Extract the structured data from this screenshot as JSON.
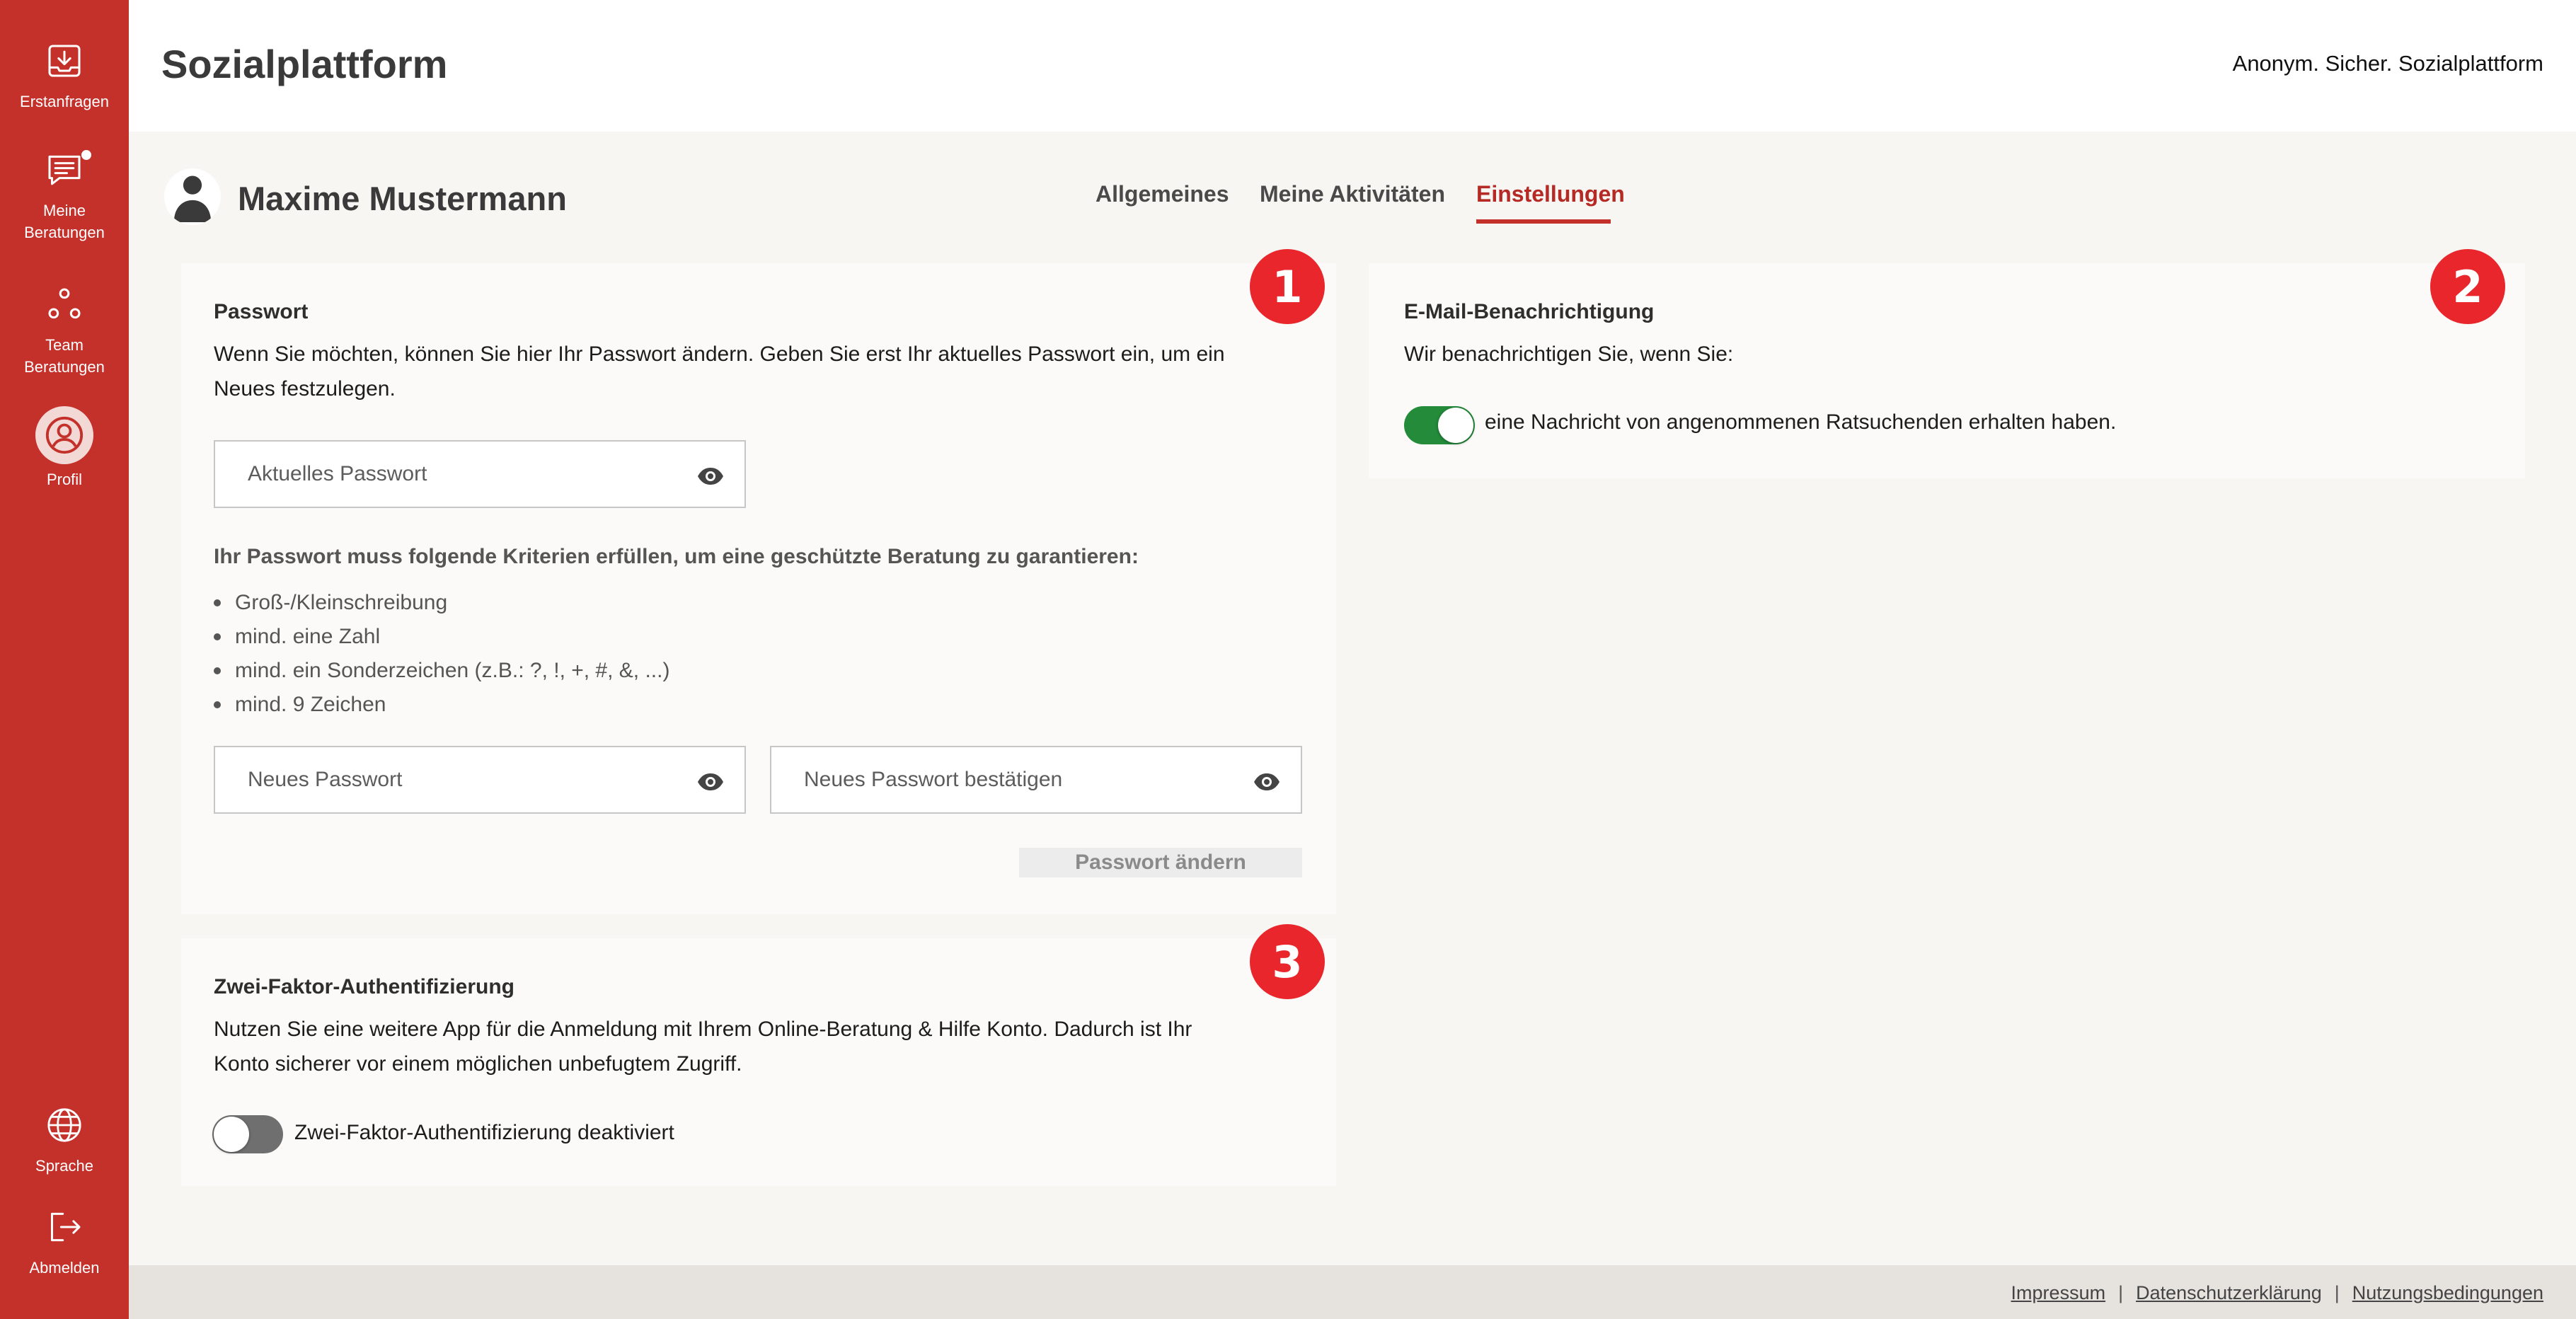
{
  "colors": {
    "brand": "#c4302a",
    "badge": "#e8262b",
    "toggle_on": "#238b3a",
    "toggle_off": "#6f6f6f"
  },
  "sidebar": {
    "items": [
      {
        "label": "Erstanfragen",
        "icon": "inbox-download-icon"
      },
      {
        "label": "Meine Beratungen",
        "icon": "chat-lines-icon",
        "has_notification_dot": true
      },
      {
        "label": "Team Beratungen",
        "icon": "team-nodes-icon"
      },
      {
        "label": "Profil",
        "icon": "user-circle-icon",
        "active": true
      }
    ],
    "bottom_items": [
      {
        "label": "Sprache",
        "icon": "globe-icon"
      },
      {
        "label": "Abmelden",
        "icon": "logout-icon"
      }
    ]
  },
  "header": {
    "title": "Sozialplattform",
    "tagline": "Anonym. Sicher. Sozialplattform"
  },
  "profile": {
    "name": "Maxime Mustermann",
    "tabs": [
      {
        "label": "Allgemeines"
      },
      {
        "label": "Meine Aktivitäten"
      },
      {
        "label": "Einstellungen",
        "active": true
      }
    ]
  },
  "password_card": {
    "badge": "1",
    "title": "Passwort",
    "intro_line1": "Wenn Sie möchten, können Sie hier Ihr Passwort ändern. Geben Sie erst Ihr aktuelles Passwort ein, um ein",
    "intro_line2": "Neues festzulegen.",
    "current_placeholder": "Aktuelles Passwort",
    "criteria_heading": "Ihr Passwort muss folgende Kriterien erfüllen, um eine geschützte Beratung zu garantieren:",
    "criteria": [
      "Groß-/Kleinschreibung",
      "mind. eine Zahl",
      "mind. ein Sonderzeichen (z.B.: ?, !, +, #, &, ...)",
      "mind. 9 Zeichen"
    ],
    "new_placeholder": "Neues Passwort",
    "confirm_placeholder": "Neues Passwort bestätigen",
    "submit_label": "Passwort ändern"
  },
  "email_card": {
    "badge": "2",
    "title": "E-Mail-Benachrichtigung",
    "intro": "Wir benachrichtigen Sie, wenn Sie:",
    "toggle_label": "eine Nachricht von angenommenen Ratsuchenden erhalten haben.",
    "toggle_on": true
  },
  "twofa_card": {
    "badge": "3",
    "title": "Zwei-Faktor-Authentifizierung",
    "intro_line1": "Nutzen Sie eine weitere App für die Anmeldung mit Ihrem Online-Beratung & Hilfe Konto. Dadurch ist Ihr",
    "intro_line2": "Konto sicherer vor einem möglichen unbefugtem Zugriff.",
    "toggle_label": "Zwei-Faktor-Authentifizierung deaktiviert",
    "toggle_on": false
  },
  "footer": {
    "links": [
      "Impressum",
      "Datenschutzerklärung",
      "Nutzungsbedingungen"
    ],
    "separator": "|"
  }
}
